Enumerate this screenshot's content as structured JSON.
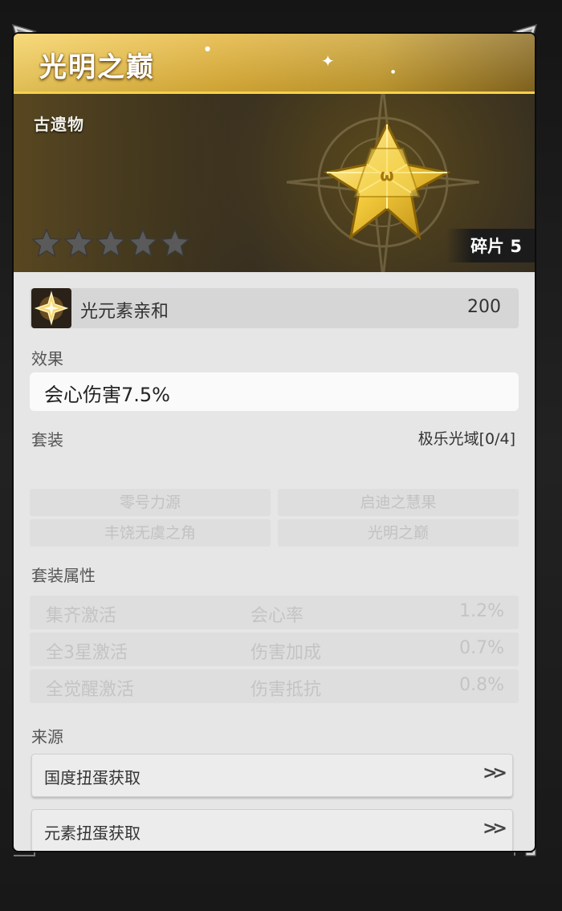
{
  "item": {
    "name": "光明之巅",
    "rarity_label": "古遗物",
    "stars_total": 5,
    "stars_filled": 0,
    "shards_label": "碎片 5"
  },
  "stat": {
    "icon": "light-element-icon",
    "label": "光元素亲和",
    "value": "200"
  },
  "effect": {
    "heading": "效果",
    "text": "会心伤害7.5%"
  },
  "set": {
    "heading": "套装",
    "name": "极乐光域[0/4]",
    "pieces": [
      "零号力源",
      "启迪之慧果",
      "丰饶无虞之角",
      "光明之巅"
    ]
  },
  "set_attributes": {
    "heading": "套装属性",
    "rows": [
      {
        "condition": "集齐激活",
        "attribute": "会心率",
        "value": "1.2%"
      },
      {
        "condition": "全3星激活",
        "attribute": "伤害加成",
        "value": "0.7%"
      },
      {
        "condition": "全觉醒激活",
        "attribute": "伤害抵抗",
        "value": "0.8%"
      }
    ]
  },
  "source": {
    "heading": "来源",
    "items": [
      {
        "label": "国度扭蛋获取",
        "icon": "double-chevron-right-icon"
      },
      {
        "label": "元素扭蛋获取",
        "icon": "double-chevron-right-icon"
      }
    ]
  },
  "colors": {
    "title_gold": "#e3b338",
    "hero_dark": "#2b2822",
    "panel_bg": "#e6e6e6",
    "inactive_text": "#c4c4c4"
  }
}
